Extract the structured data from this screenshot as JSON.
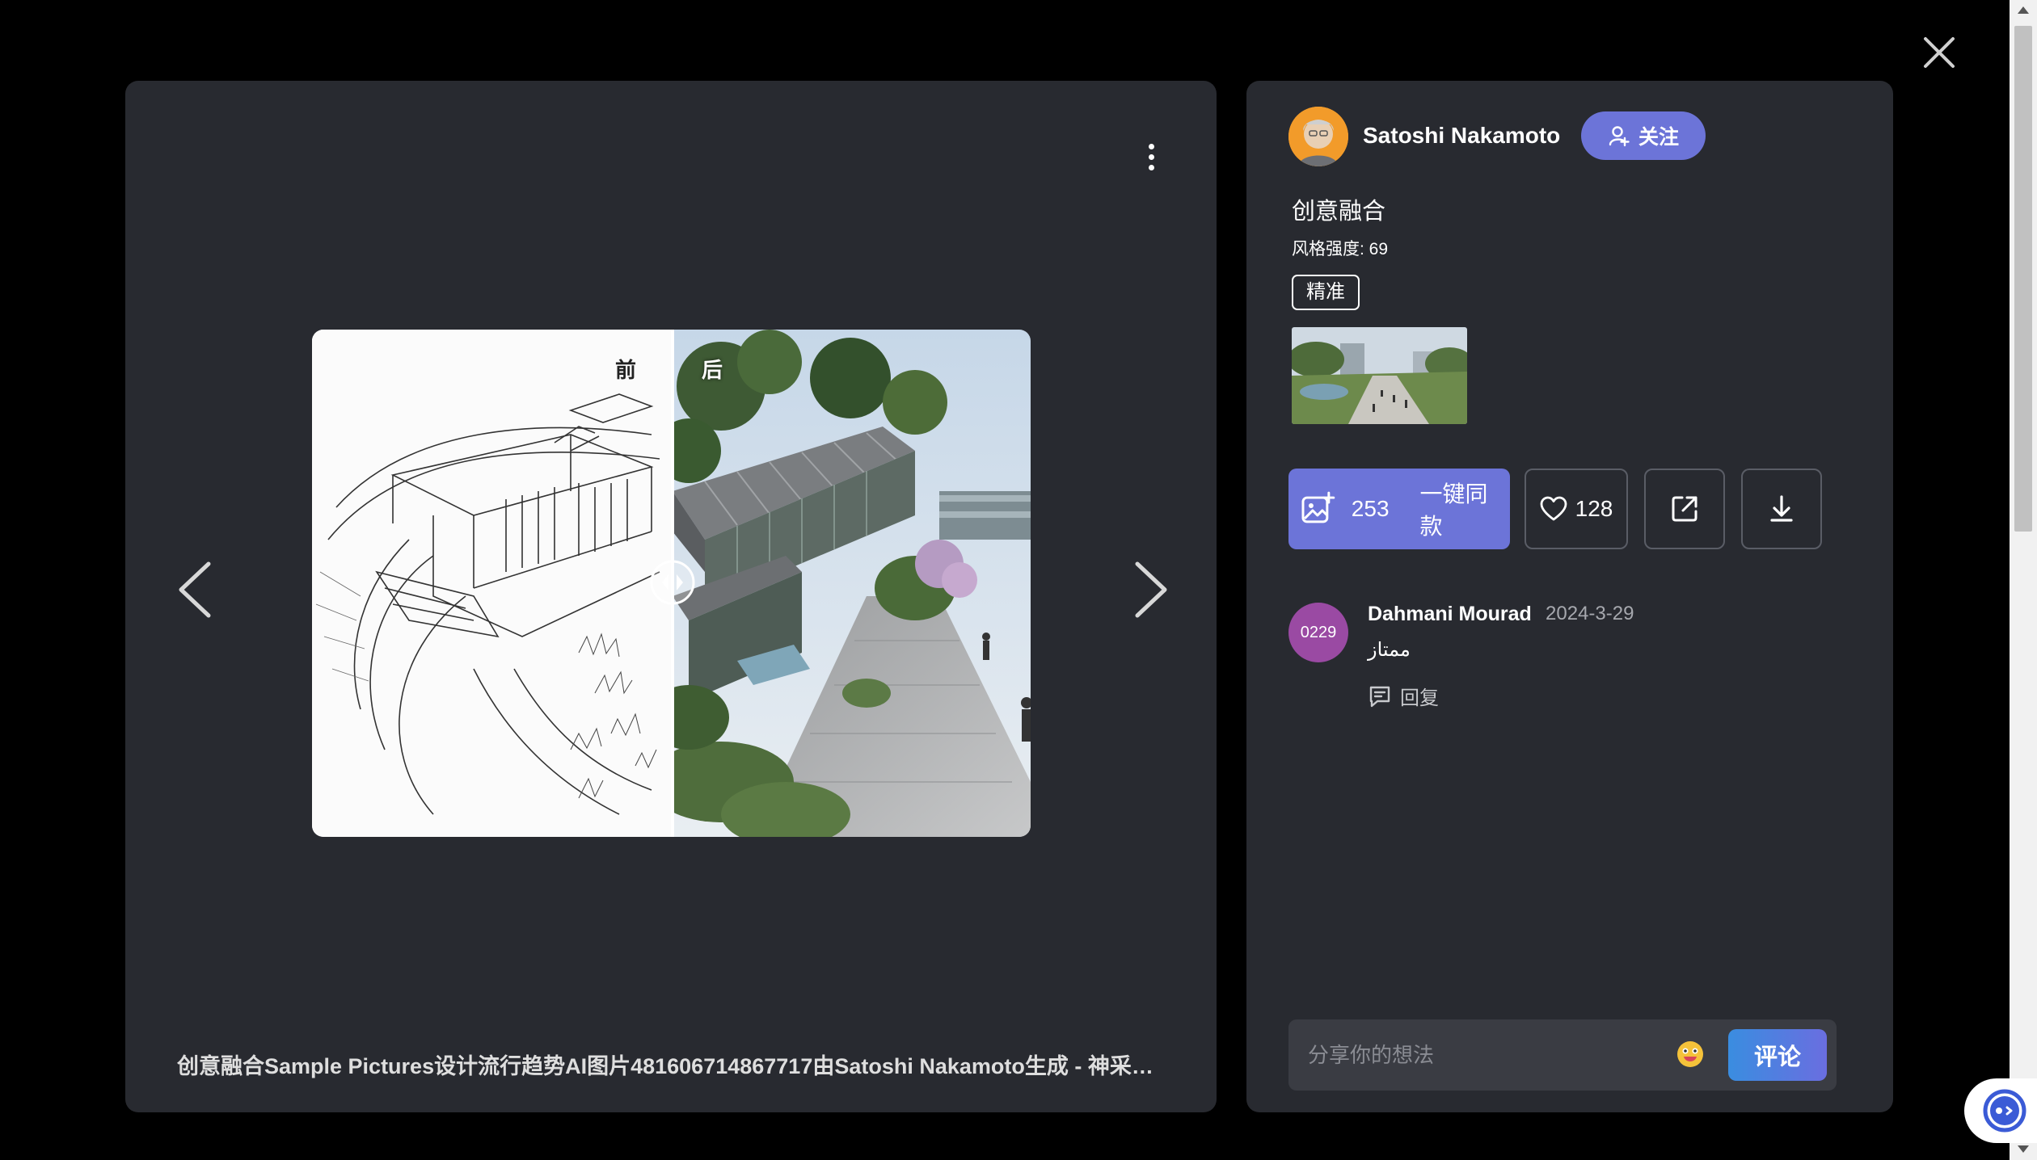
{
  "viewer": {
    "close_icon": "close-icon",
    "prev_icon": "chevron-left-icon",
    "next_icon": "chevron-right-icon",
    "more_icon": "more-vertical-icon",
    "compare": {
      "before_label": "前",
      "after_label": "后"
    },
    "caption": "创意融合Sample Pictures设计流行趋势AI图片481606714867717由Satoshi Nakamoto生成 - 神采Prom..."
  },
  "author": {
    "name": "Satoshi Nakamoto",
    "follow_label": "关注"
  },
  "details": {
    "title": "创意融合",
    "strength": "风格强度: 69",
    "tag": "精准"
  },
  "actions": {
    "same_count": "253",
    "same_label": "一键同款",
    "like_count": "128",
    "share_icon": "share-icon",
    "download_icon": "download-icon"
  },
  "comments": [
    {
      "avatar_text": "0229",
      "name": "Dahmani Mourad",
      "date": "2024-3-29",
      "text": "ممتاز",
      "reply_label": "回复"
    }
  ],
  "comment_box": {
    "placeholder": "分享你的想法",
    "submit_label": "评论"
  },
  "colors": {
    "accent": "#6c74d8",
    "panel": "#282a30",
    "backdrop": "#000000",
    "comment_avatar": "#9a4aa3"
  }
}
